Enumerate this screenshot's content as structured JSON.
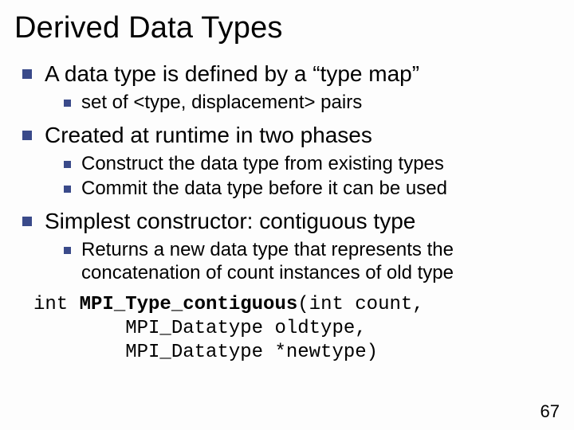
{
  "title": "Derived Data Types",
  "b1": {
    "text": "A data type is defined by a “type map”",
    "sub": {
      "a": "set of <type, displacement> pairs"
    }
  },
  "b2": {
    "text": "Created at runtime in two phases",
    "sub": {
      "a": "Construct the data type from existing types",
      "b": "Commit the data type before it can be used"
    }
  },
  "b3": {
    "text": "Simplest constructor: contiguous type",
    "sub": {
      "a": "Returns a new data type that represents the concatenation of count instances of old type"
    }
  },
  "code": {
    "l1a": "int ",
    "l1b": "MPI_Type_contiguous",
    "l1c": "(int count,",
    "l2": "        MPI_Datatype oldtype,",
    "l3": "        MPI_Datatype *newtype)"
  },
  "page": "67"
}
